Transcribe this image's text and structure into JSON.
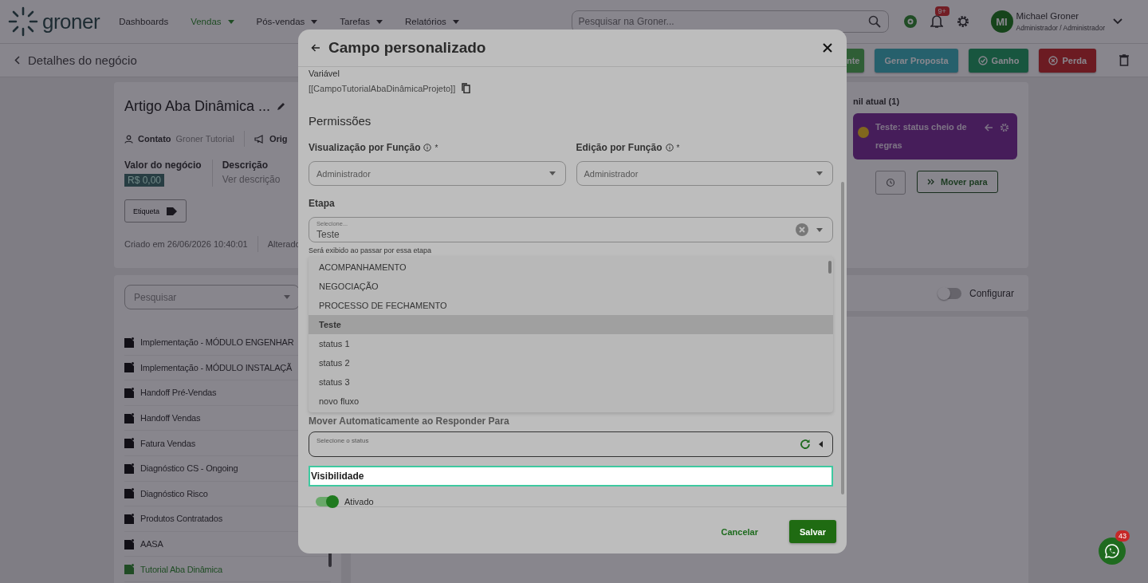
{
  "nav": {
    "logo": "groner",
    "items": [
      {
        "label": "Dashboards",
        "selected": false,
        "dropdown": false
      },
      {
        "label": "Vendas",
        "selected": true,
        "dropdown": true
      },
      {
        "label": "Pós-vendas",
        "selected": false,
        "dropdown": true
      },
      {
        "label": "Tarefas",
        "selected": false,
        "dropdown": true
      },
      {
        "label": "Relatórios",
        "selected": false,
        "dropdown": true
      }
    ],
    "search": {
      "placeholder": "Pesquisar na Groner..."
    },
    "notifications_badge": "9+",
    "user": {
      "initials": "MI",
      "name": "Michael Groner",
      "role": "Administrador / Administrador"
    }
  },
  "breadcrumb": {
    "title": "Detalhes do negócio"
  },
  "actions": [
    {
      "label": "nte",
      "kind": "green"
    },
    {
      "label": "Gerar Proposta",
      "kind": "teal"
    },
    {
      "label": "Ganho",
      "kind": "won"
    },
    {
      "label": "Perda",
      "kind": "lost"
    }
  ],
  "deal": {
    "title": "Artigo Aba Dinâmica ...",
    "contact_label": "Contato",
    "contact": "Groner Tutorial",
    "origin_label": "Orig",
    "value_label": "Valor do negócio",
    "value": "R$ 0,00",
    "description_label": "Descrição",
    "description_link": "Ver descrição",
    "tag_button": "Etiqueta",
    "created": "Criado em 26/06/2026 10:40:01",
    "changed": "Alterado"
  },
  "funnel": {
    "title": "nil atual (1)",
    "stage": "Teste: status cheio de regras",
    "move_button": "Mover para"
  },
  "list": {
    "placeholder": "Pesquisar",
    "items": [
      {
        "label": "Implementação - MÓDULO ENGENHAR",
        "selected": false
      },
      {
        "label": "Implementação - MÓDULO INSTALAÇÃ",
        "selected": false
      },
      {
        "label": "Handoff Pré-Vendas",
        "selected": false
      },
      {
        "label": "Handoff Vendas",
        "selected": false
      },
      {
        "label": "Fatura Vendas",
        "selected": false
      },
      {
        "label": "Diagnóstico CS - Ongoing",
        "selected": false
      },
      {
        "label": "Diagnóstico Risco",
        "selected": false
      },
      {
        "label": "Produtos Contratados",
        "selected": false
      },
      {
        "label": "AASA",
        "selected": false
      },
      {
        "label": "Tutorial Aba Dinâmica",
        "selected": true
      }
    ]
  },
  "configure": {
    "label": "Configurar",
    "on": false
  },
  "chat_badge": "43",
  "modal": {
    "title": "Campo personalizado",
    "variable_label": "Variável",
    "variable": "[[CampoTutorialAbaDinâmicaProjeto]]",
    "section": "Permissões",
    "role_fields": [
      {
        "label": "Visualização por Função",
        "mark": "*",
        "value": "Administrador"
      },
      {
        "label": "Edição por Função",
        "mark": "*",
        "value": "Administrador"
      }
    ],
    "stage": {
      "label": "Etapa",
      "floating_label": "Selecione...",
      "value": "Teste",
      "help": "Será exibido ao passar por essa etapa"
    },
    "stage_options": [
      {
        "label": "ACOMPANHAMENTO",
        "selected": false
      },
      {
        "label": "NEGOCIAÇÃO",
        "selected": false
      },
      {
        "label": "PROCESSO DE FECHAMENTO",
        "selected": false
      },
      {
        "label": "Teste",
        "selected": true
      },
      {
        "label": "status 1",
        "selected": false
      },
      {
        "label": "status 2",
        "selected": false
      },
      {
        "label": "status 3",
        "selected": false
      },
      {
        "label": "novo fluxo",
        "selected": false
      }
    ],
    "move": {
      "label": "Mover Automaticamente ao Responder Para",
      "placeholder": "Selecione o status"
    },
    "visibility": {
      "label": "Visibilidade",
      "toggle_label": "Ativado",
      "on": true
    },
    "buttons": [
      {
        "label": "Cancelar",
        "kind": "text"
      },
      {
        "label": "Salvar",
        "kind": "primary"
      }
    ]
  }
}
